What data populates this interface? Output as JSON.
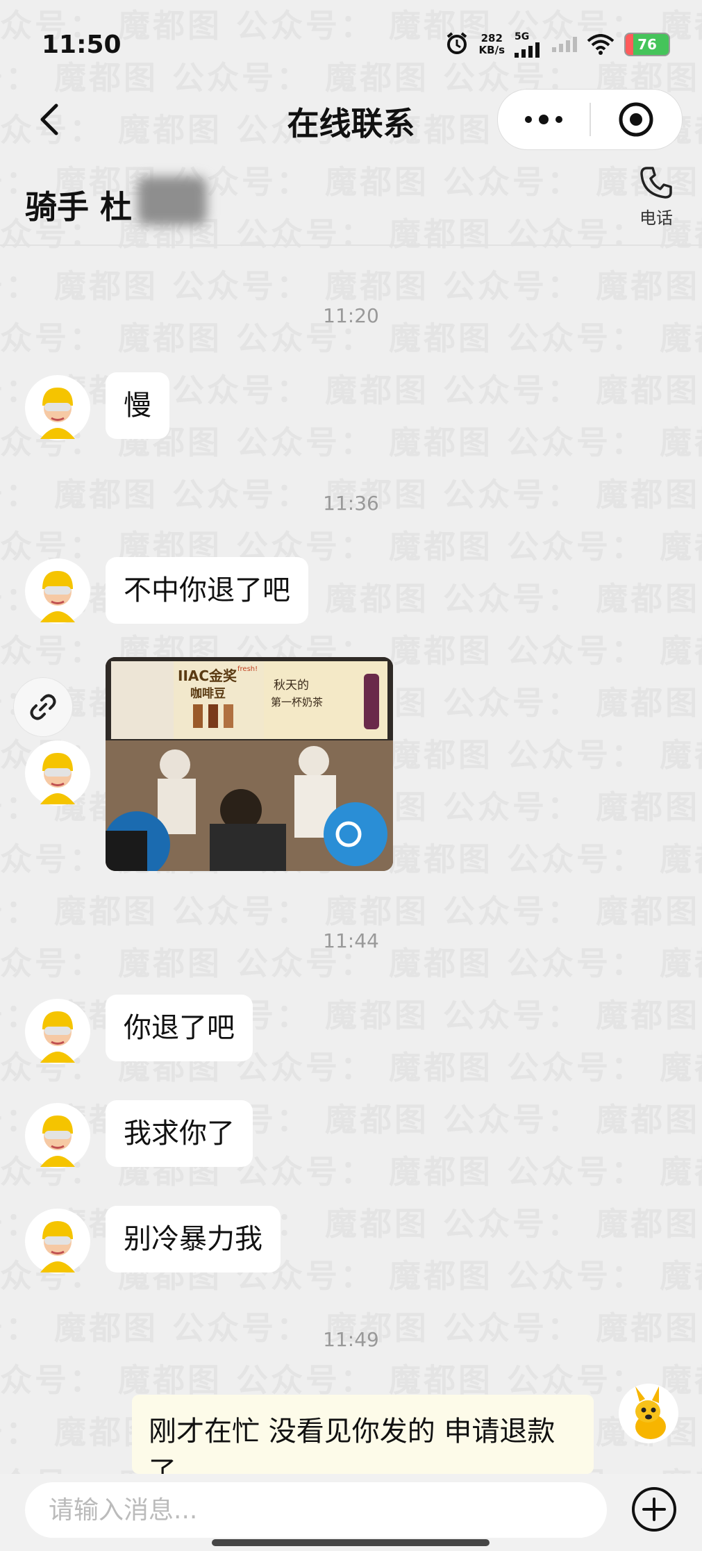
{
  "status_bar": {
    "time": "11:50",
    "speed_value": "282",
    "speed_unit": "KB/s",
    "network": "5G",
    "battery": "76"
  },
  "nav": {
    "title": "在线联系"
  },
  "contact": {
    "name": "骑手 杜",
    "call_label": "电话"
  },
  "watermark_text": "公众号：魔都图",
  "messages": [
    {
      "type": "timestamp",
      "text": "11:20"
    },
    {
      "type": "incoming",
      "text": "慢"
    },
    {
      "type": "timestamp",
      "text": "11:36"
    },
    {
      "type": "incoming",
      "text": "不中你退了吧"
    },
    {
      "type": "incoming_image",
      "signs": [
        "IIAC金奖",
        "咖啡豆",
        "fresh!",
        "秋天的",
        "第一杯奶茶"
      ]
    },
    {
      "type": "timestamp",
      "text": "11:44"
    },
    {
      "type": "incoming",
      "text": "你退了吧"
    },
    {
      "type": "incoming",
      "text": "我求你了"
    },
    {
      "type": "incoming",
      "text": "别冷暴力我"
    },
    {
      "type": "timestamp",
      "text": "11:49"
    },
    {
      "type": "outgoing",
      "text": "刚才在忙 没看见你发的 申请退款了"
    }
  ],
  "input": {
    "placeholder": "请输入消息..."
  },
  "colors": {
    "background": "#efefef",
    "bubble_incoming": "#ffffff",
    "bubble_outgoing": "#fdfbe9",
    "rider_helmet": "#f5c400",
    "timestamp": "#999999"
  },
  "icons": {
    "back": "chevron-left-icon",
    "more": "more-dots-icon",
    "close": "target-circle-icon",
    "call": "phone-icon",
    "link": "link-icon",
    "add": "plus-circle-icon"
  }
}
